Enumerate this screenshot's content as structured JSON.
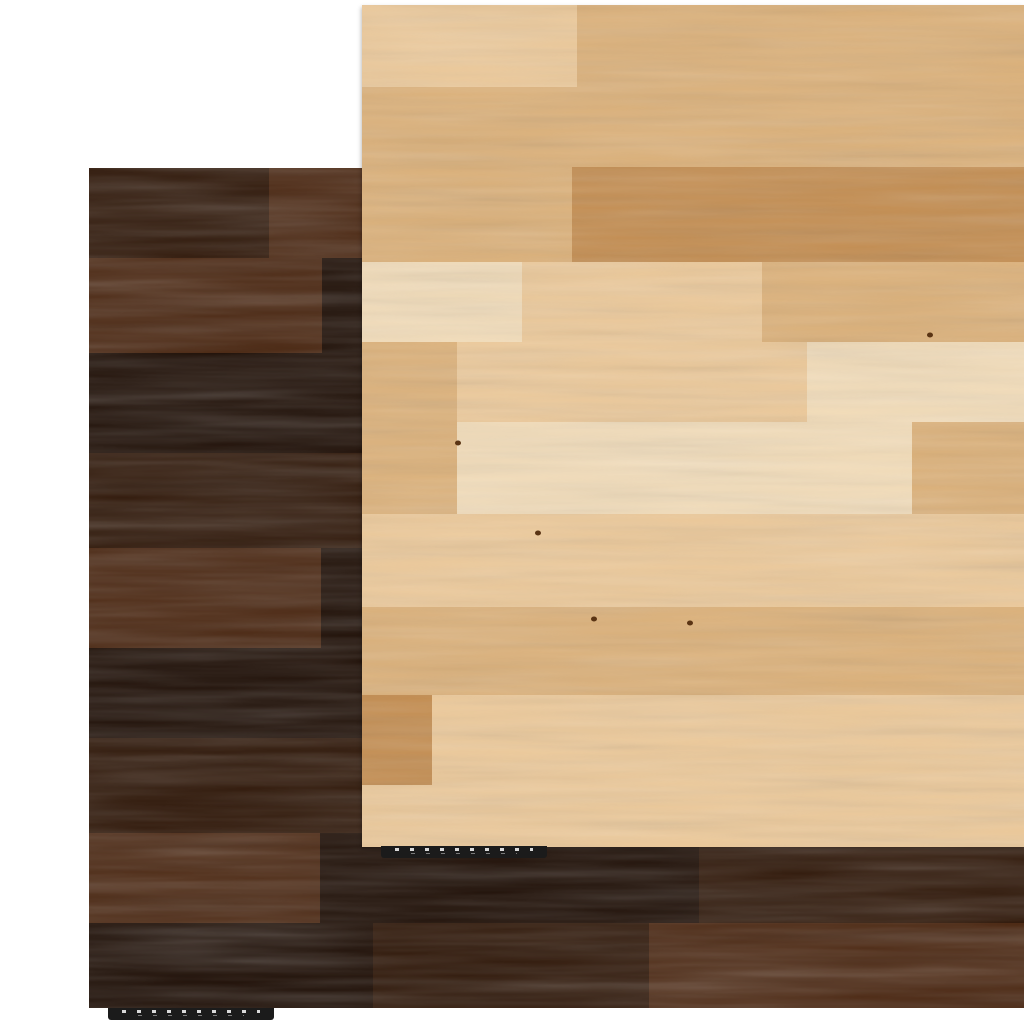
{
  "colors": {
    "background": "#ffffff",
    "dark_wood_base": "#2e1607",
    "dark_wood_light": "#4a2610",
    "dark_wood_deep": "#1c0c03",
    "light_wood_base": "#dcb17a",
    "light_wood_light": "#ecc99a",
    "light_wood_pale": "#f2dcb9",
    "light_wood_deep": "#c48e52",
    "tag_background": "#1b1b1b",
    "tag_marks": "#d8d8d8"
  }
}
